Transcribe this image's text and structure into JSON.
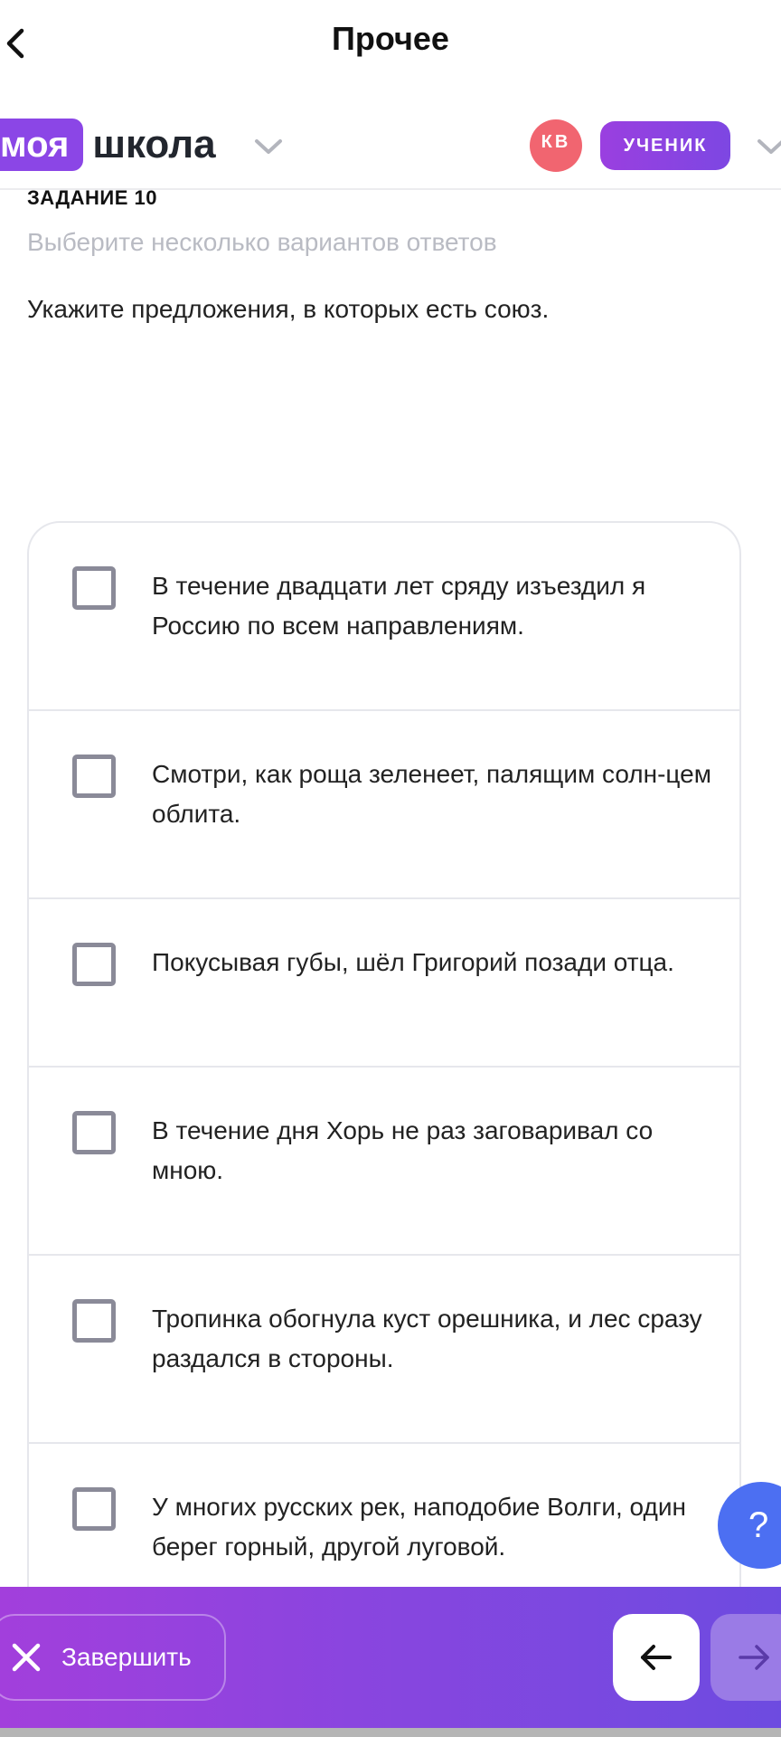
{
  "header": {
    "title": "Прочее"
  },
  "brand": {
    "part1": "моя",
    "part2": "школа"
  },
  "user": {
    "initials": "КВ",
    "role": "УЧЕНИК"
  },
  "task": {
    "number_label": "ЗАДАНИЕ 10",
    "hint": "Выберите несколько вариантов ответов",
    "question": "Укажите предложения, в которых есть союз."
  },
  "options": [
    {
      "text": "В течение двадцати лет сряду изъездил я Россию по всем направлениям.",
      "checked": false
    },
    {
      "text": "Смотри, как роща зеленеет, палящим солн-цем облита.",
      "checked": false
    },
    {
      "text": "Покусывая губы, шёл Григорий позади отца.",
      "checked": false
    },
    {
      "text": "В течение дня Хорь не раз заговаривал со мною.",
      "checked": false
    },
    {
      "text": "Тропинка обогнула куст орешника, и лес сразу раздался в стороны.",
      "checked": false
    },
    {
      "text": "У многих русских рек, наподобие Волги, один берег горный, другой луговой.",
      "checked": false
    }
  ],
  "help": {
    "label": "?"
  },
  "footer": {
    "finish_label": "Завершить"
  },
  "colors": {
    "brand_purple": "#8b46e6",
    "avatar_red": "#f16570",
    "help_blue": "#4c6ff2",
    "checkbox_border": "#8a8a98"
  }
}
